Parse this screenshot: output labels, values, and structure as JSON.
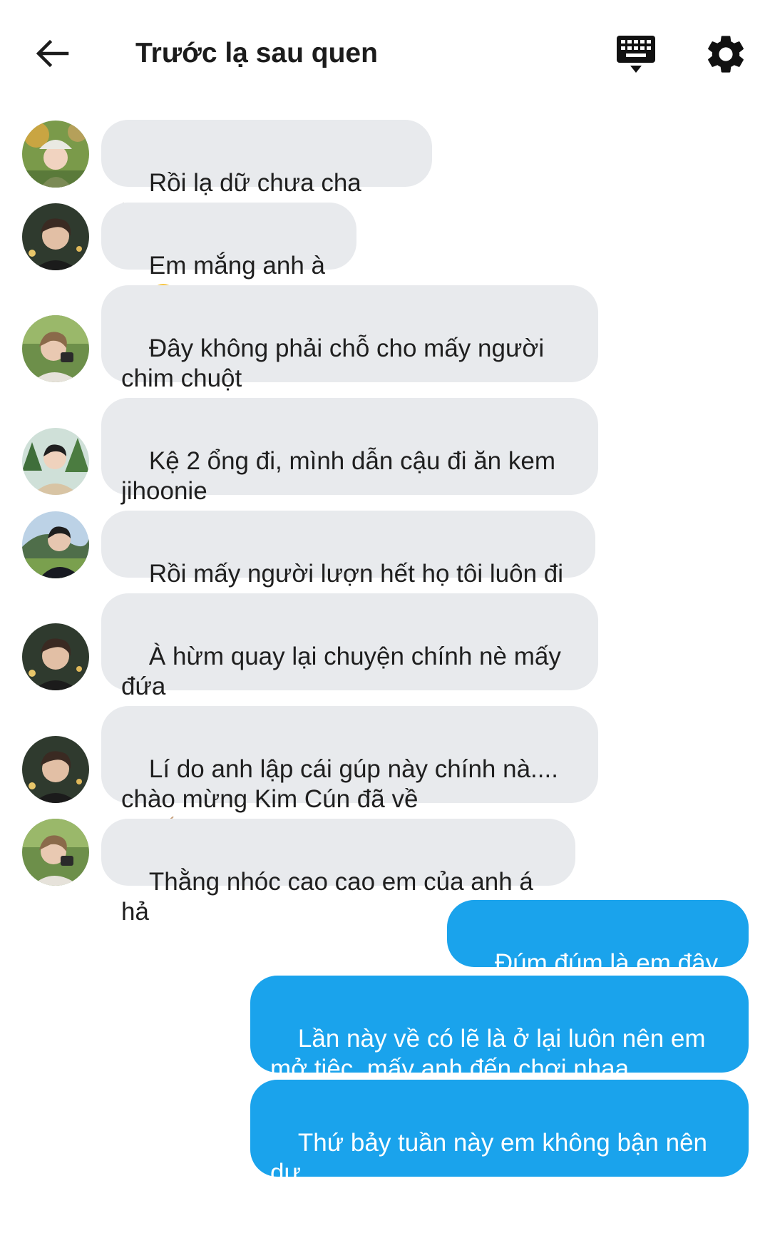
{
  "header": {
    "title": "Trước lạ sau quen",
    "back_icon": "arrow-left-icon",
    "keyboard_icon": "keyboard-icon",
    "settings_icon": "gear-icon"
  },
  "colors": {
    "incoming_bubble": "#e8eaed",
    "outgoing_bubble": "#1aa3ec",
    "text": "#1f1f1f"
  },
  "messages": [
    {
      "direction": "in",
      "avatar": "avatar-bucket-hat",
      "text": "Rồi lạ dữ chưa cha kia???"
    },
    {
      "direction": "in",
      "avatar": "avatar-dark-hair",
      "text": "Em mắng anh à",
      "emoji": "pleading-face-icon"
    },
    {
      "direction": "in",
      "avatar": "avatar-camera",
      "text": "Đây không phải chỗ cho mấy người\nchim chuột"
    },
    {
      "direction": "in",
      "avatar": "avatar-trees",
      "text": "Kệ 2 ổng đi, mình dẫn cậu đi ăn kem\njihoonie"
    },
    {
      "direction": "in",
      "avatar": "avatar-mountain",
      "text": "Rồi mấy người lượn hết họ tôi luôn đi =)"
    },
    {
      "direction": "in",
      "avatar": "avatar-dark-hair",
      "text": "À hừm quay lại chuyện chính nè mấy\nđứa"
    },
    {
      "direction": "in",
      "avatar": "avatar-dark-hair",
      "text": "Lí do anh lập cái gúp này chính nà....\nchào mừng Kim Cún đã về",
      "emoji": "clapping-hands-icon"
    },
    {
      "direction": "in",
      "avatar": "avatar-camera",
      "text": "Thằng nhóc cao cao em của anh á hả"
    },
    {
      "direction": "out",
      "text": "Đúm đúm là em đây ^^"
    },
    {
      "direction": "out",
      "text": "Lần này về có lẽ là ở lại luôn nên em\nmở tiệc, mấy anh đến chơi nhaa"
    },
    {
      "direction": "out",
      "text": "Thứ bảy tuần này em không bận nên dự\nđịnh tổ chức. Có ai bận hăm ạ?"
    }
  ]
}
